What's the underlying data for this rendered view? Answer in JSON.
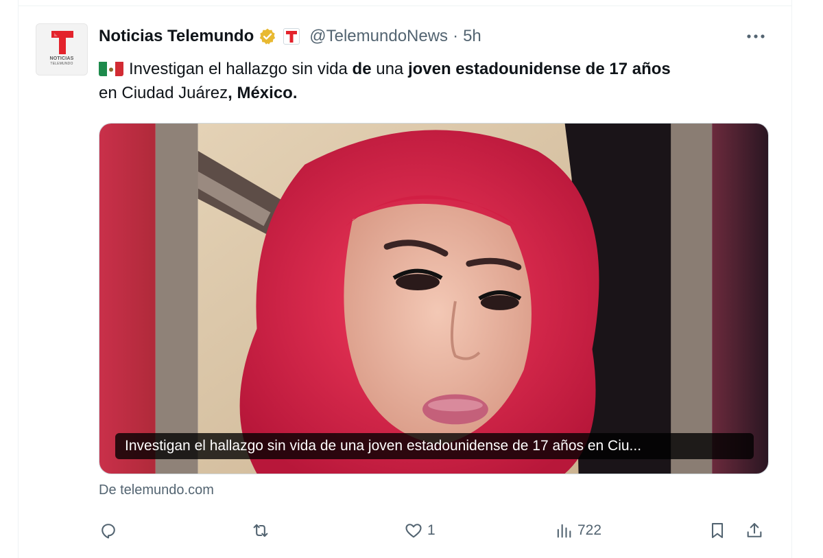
{
  "tweet": {
    "author": {
      "display_name": "Noticias Telemundo",
      "handle": "@TelemundoNews",
      "time": "5h",
      "avatar_text_line1": "NOTICIAS",
      "avatar_text_line2": "TELEMUNDO",
      "brand_color": "#e3232c",
      "verified_badge_color": "#e8b931"
    },
    "separator": "·",
    "more_icon": "more-options-icon",
    "text": {
      "flag": "mexico-flag",
      "parts": [
        {
          "text": "Investigan el hallazgo sin vida ",
          "bold": false
        },
        {
          "text": "de",
          "bold": true
        },
        {
          "text": " una ",
          "bold": false
        },
        {
          "text": "joven estadounidense de 17 años",
          "bold": true
        },
        {
          "text": " en Ciudad Juárez",
          "bold": false
        },
        {
          "text": ", México.",
          "bold": true
        }
      ]
    },
    "card": {
      "title": "Investigan el hallazgo sin vida de una joven estadounidense de 17 años en Ciu...",
      "image_description_icon": "photo-of-young-woman-with-red-hair"
    },
    "source": "De telemundo.com",
    "actions": {
      "reply_icon": "reply-icon",
      "retweet_icon": "retweet-icon",
      "like_icon": "like-icon",
      "like_count": "1",
      "views_icon": "views-icon",
      "views_count": "722",
      "bookmark_icon": "bookmark-icon",
      "share_icon": "share-icon"
    }
  }
}
